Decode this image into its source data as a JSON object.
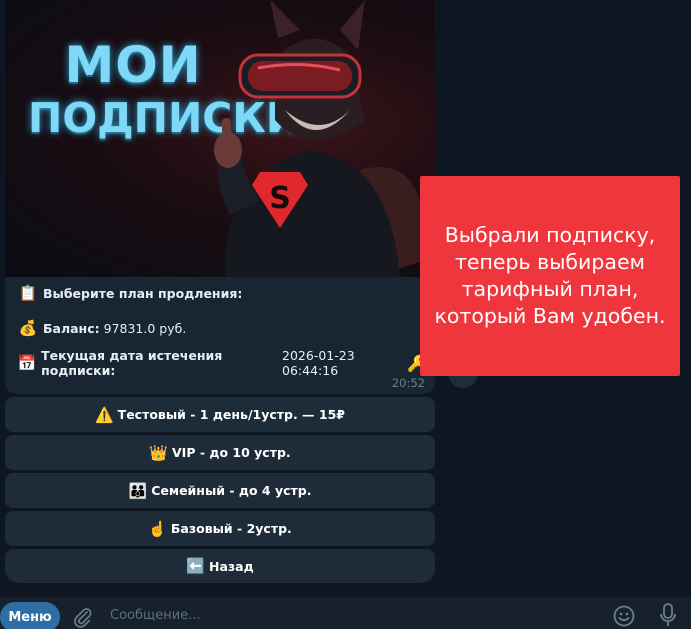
{
  "message": {
    "hero": {
      "title_line1": "МОИ",
      "title_line2": "ПОДПИСКИ",
      "emblem_letter": "S"
    },
    "lines": [
      {
        "icon": "📋",
        "icon_name": "clipboard-icon",
        "text": "Выберите план продления:"
      },
      {
        "icon": "💰",
        "icon_name": "money-bag-icon",
        "label": "Баланс:",
        "value": "97831.0 руб."
      },
      {
        "icon": "📅",
        "icon_name": "calendar-icon",
        "label": "Текущая дата истечения подписки:",
        "value": "2026-01-23 06:44:16",
        "trail_icon": "🔑"
      }
    ],
    "time": "20:52"
  },
  "keyboard": [
    {
      "icon": "⚠️",
      "icon_name": "warning-icon",
      "label": "Тестовый - 1 день/1устр. — 15₽"
    },
    {
      "icon": "👑",
      "icon_name": "crown-icon",
      "label": "VIP - до 10 устр."
    },
    {
      "icon": "👪",
      "icon_name": "family-icon",
      "label": "Семейный - до 4 устр."
    },
    {
      "icon": "☝️",
      "icon_name": "pointing-up-icon",
      "label": "Базовый - 2устр."
    },
    {
      "icon": "⬅️",
      "icon_name": "back-arrow-icon",
      "label": "Назад"
    }
  ],
  "callout": {
    "text": "Выбрали подписку, теперь выбираем тарифный план, который Вам удобен."
  },
  "composer": {
    "menu_label": "Меню",
    "placeholder": "Сообщение..."
  },
  "colors": {
    "background": "#0e1621",
    "bubble": "#182533",
    "button": "#1e2c3a",
    "callout": "#f0363d",
    "menu": "#2f6ea5",
    "title_glow": "#7fd8f5",
    "emblem": "#e0282e"
  }
}
